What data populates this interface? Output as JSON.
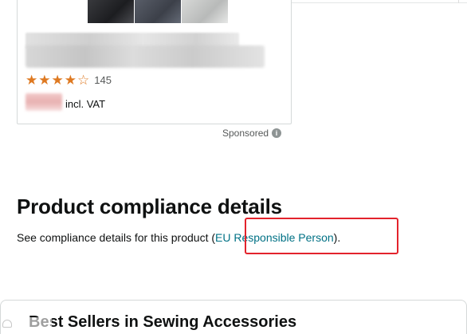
{
  "product_card": {
    "rating_stars": 4,
    "rating_max": 5,
    "rating_count": "145",
    "price_suffix": "incl. VAT"
  },
  "sponsored": {
    "label": "Sponsored",
    "icon": "info-icon",
    "icon_glyph": "i"
  },
  "compliance": {
    "heading": "Product compliance details",
    "text_before": "See compliance details for this product (",
    "link_label": "EU Responsible Person",
    "text_after": ")."
  },
  "best_sellers": {
    "title": "Best Sellers in Sewing Accessories"
  },
  "colors": {
    "link": "#007185",
    "highlight": "#e3232c",
    "star": "#de7921"
  }
}
